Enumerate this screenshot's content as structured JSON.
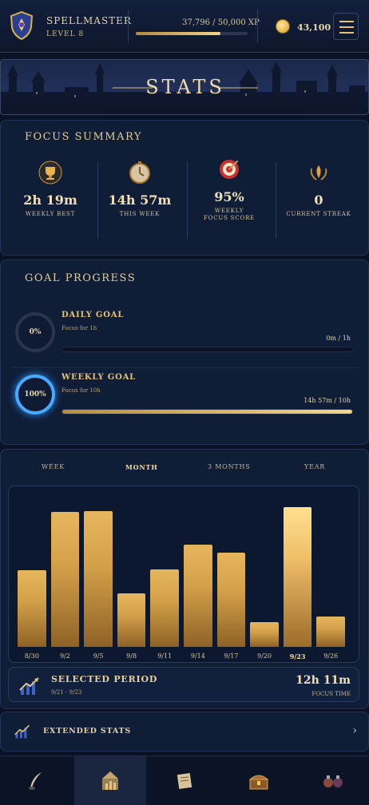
{
  "header": {
    "username": "SPELLMASTER",
    "level": "LEVEL 8",
    "xp_text": "37,796 / 50,000 XP",
    "xp_progress": 0.756,
    "coins": "43,100",
    "menu_icon": "hamburger-icon",
    "avatar_icon": "shield-crest-icon"
  },
  "banner": {
    "title": "STATS"
  },
  "focus_summary": {
    "title": "FOCUS SUMMARY",
    "stats": [
      {
        "icon": "trophy-icon",
        "value": "2h 19m",
        "label": "WEEKLY BEST"
      },
      {
        "icon": "stopwatch-icon",
        "value": "14h 57m",
        "label": "THIS WEEK"
      },
      {
        "icon": "target-icon",
        "value": "95%",
        "label": "WEEKLY FOCUS SCORE"
      },
      {
        "icon": "laurel-flame-icon",
        "value": "0",
        "label": "CURRENT STREAK"
      }
    ]
  },
  "goal_progress": {
    "title": "GOAL PROGRESS",
    "goals": [
      {
        "percent": "0%",
        "progress": 0,
        "title": "DAILY GOAL",
        "subtitle": "Focus for 1h",
        "amount": "0m / 1h"
      },
      {
        "percent": "100%",
        "progress": 1,
        "title": "WEEKLY GOAL",
        "subtitle": "Focus for 10h",
        "amount": "14h 57m / 10h"
      }
    ]
  },
  "tabs": [
    "WEEK",
    "MONTH",
    "3 MONTHS",
    "YEAR"
  ],
  "active_tab": "MONTH",
  "chart_data": {
    "type": "bar",
    "categories": [
      "8/30",
      "9/2",
      "9/5",
      "9/8",
      "9/11",
      "9/14",
      "9/17",
      "9/20",
      "9/23",
      "9/26"
    ],
    "values": [
      9.7,
      17.1,
      17.2,
      6.8,
      9.8,
      12.9,
      11.9,
      3.1,
      17.7,
      3.8
    ],
    "selected_category": "9/23",
    "ylim": [
      0,
      19
    ]
  },
  "selected_period": {
    "title": "SELECTED PERIOD",
    "range": "9/21 - 9/23",
    "value": "12h 11m",
    "value_label": "FOCUS TIME",
    "icon": "rising-chart-icon"
  },
  "extended_stats": {
    "title": "EXTENDED STATS",
    "icon": "rising-chart-icon",
    "chevron": "›"
  },
  "bottom_nav": [
    {
      "icon": "quill-icon"
    },
    {
      "icon": "stats-castle-icon"
    },
    {
      "icon": "scroll-icon"
    },
    {
      "icon": "treasure-chest-icon"
    },
    {
      "icon": "potion-shelf-icon"
    }
  ],
  "colors": {
    "accent_gold": "#e3c27a",
    "accent_blue": "#3aa3ff",
    "background": "#0a1326"
  }
}
